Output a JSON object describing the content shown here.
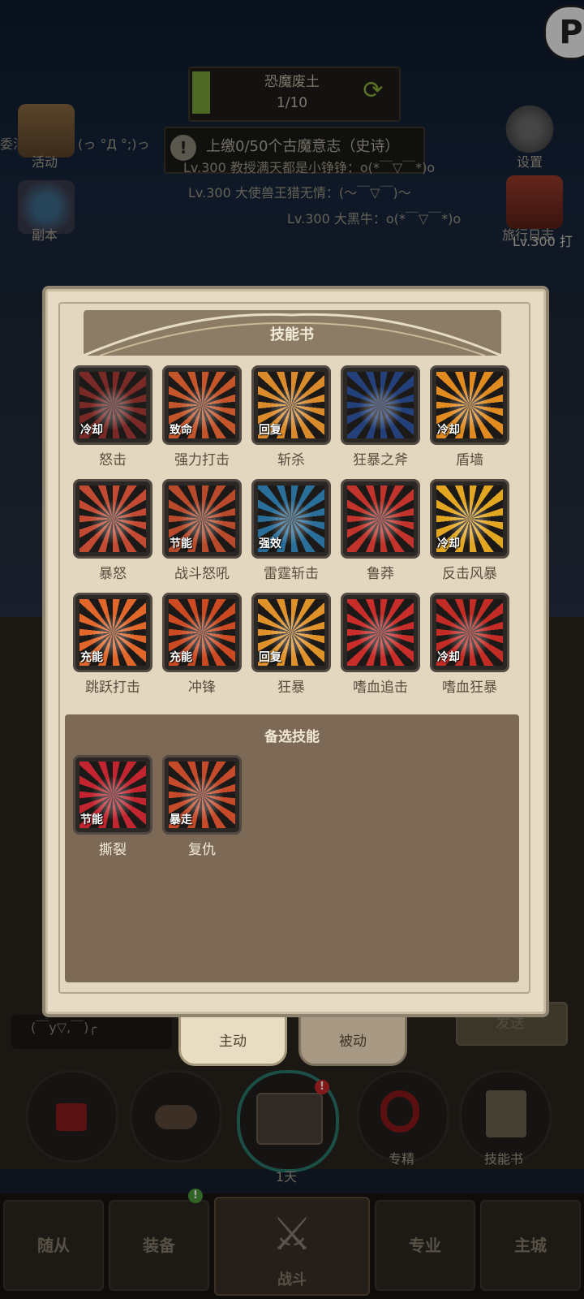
{
  "hud": {
    "stage_name": "恐魔废土",
    "stage_progress": "1/10",
    "stage_progress_fraction": 0.1,
    "tribute_text": "上缴0/50个古魔意志（史诗）",
    "chat_lines": [
      "Lv.300 教授满天都是小铮铮：o(*￣▽￣*)o",
      "Lv.300 大使兽王猎无情：(～￣▽￣)～",
      "Lv.300 大黑牛：o(*￣▽￣*)o"
    ],
    "left_chat_fragment": "委油不错哦：(っ °Д °;)っ",
    "right_chat_fragment": "Lv.300 打",
    "side_left": [
      {
        "label": "活动",
        "icon": "event-icon"
      },
      {
        "label": "副本",
        "icon": "dungeon-icon"
      }
    ],
    "side_right": [
      {
        "label": "设置",
        "icon": "gear-icon"
      },
      {
        "label": "旅行日志",
        "icon": "journal-icon"
      }
    ]
  },
  "popup": {
    "title": "技能书",
    "skills": [
      {
        "name": "怒击",
        "tag": "冷却",
        "color": "#7a2a26"
      },
      {
        "name": "强力打击",
        "tag": "致命",
        "color": "#c4552a"
      },
      {
        "name": "斩杀",
        "tag": "回复",
        "color": "#d98a2b"
      },
      {
        "name": "狂暴之斧",
        "tag": "",
        "color": "#23407a"
      },
      {
        "name": "盾墙",
        "tag": "冷却",
        "color": "#e08a1f"
      },
      {
        "name": "暴怒",
        "tag": "",
        "color": "#c24a33"
      },
      {
        "name": "战斗怒吼",
        "tag": "节能",
        "color": "#b84a2b"
      },
      {
        "name": "雷霆斩击",
        "tag": "强效",
        "color": "#2a6f9a"
      },
      {
        "name": "鲁莽",
        "tag": "",
        "color": "#c2332b"
      },
      {
        "name": "反击风暴",
        "tag": "冷却",
        "color": "#e3a620"
      },
      {
        "name": "跳跃打击",
        "tag": "充能",
        "color": "#e0662a"
      },
      {
        "name": "冲锋",
        "tag": "充能",
        "color": "#cc4a22"
      },
      {
        "name": "狂暴",
        "tag": "回复",
        "color": "#e0922a"
      },
      {
        "name": "嗜血追击",
        "tag": "",
        "color": "#c92d2a"
      },
      {
        "name": "嗜血狂暴",
        "tag": "冷却",
        "color": "#c32b25"
      }
    ],
    "reserve_title": "备选技能",
    "reserve_skills": [
      {
        "name": "撕裂",
        "tag": "节能",
        "color": "#c22530"
      },
      {
        "name": "复仇",
        "tag": "暴走",
        "color": "#c44a2a"
      }
    ]
  },
  "tabs": {
    "active": "主动",
    "inactive": "被动"
  },
  "chat_input": {
    "text": "(￣y▽,￣)╭",
    "send_label": "发送"
  },
  "quick_bar": {
    "chest_timer": "1天",
    "specialize_label": "专精",
    "skillbook_label": "技能书"
  },
  "nav": [
    {
      "label": "随从"
    },
    {
      "label": "装备"
    },
    {
      "label": "战斗"
    },
    {
      "label": "专业"
    },
    {
      "label": "主城"
    }
  ],
  "corner_badge": "P"
}
